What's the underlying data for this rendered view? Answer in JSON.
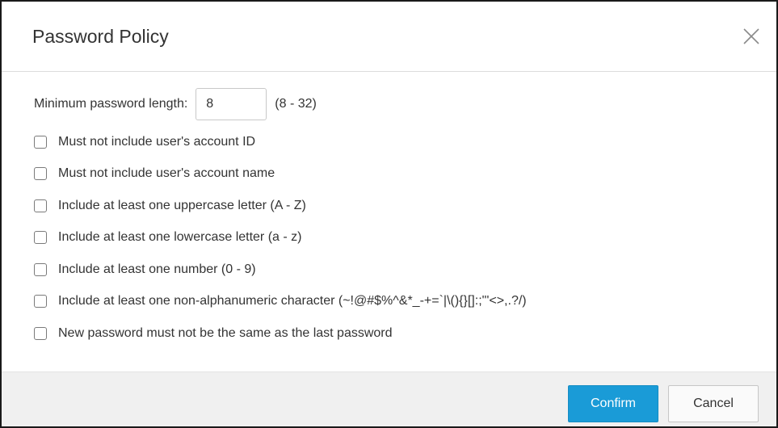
{
  "dialog": {
    "title": "Password Policy",
    "close_icon": "close-icon"
  },
  "min_length": {
    "label": "Minimum password length:",
    "value": "8",
    "range": "(8 - 32)"
  },
  "options": [
    {
      "label": "Must not include user's account ID",
      "checked": false
    },
    {
      "label": "Must not include user's account name",
      "checked": false
    },
    {
      "label": "Include at least one uppercase letter (A - Z)",
      "checked": false
    },
    {
      "label": "Include at least one lowercase letter (a - z)",
      "checked": false
    },
    {
      "label": "Include at least one number (0 - 9)",
      "checked": false
    },
    {
      "label": "Include at least one non-alphanumeric character (~!@#$%^&*_-+=`|\\(){}[]:;\"'<>,.?/)",
      "checked": false
    },
    {
      "label": "New password must not be the same as the last password",
      "checked": false
    }
  ],
  "footer": {
    "confirm_label": "Confirm",
    "cancel_label": "Cancel"
  },
  "colors": {
    "accent": "#1a9bd7",
    "footer_bg": "#f0f0f0"
  }
}
